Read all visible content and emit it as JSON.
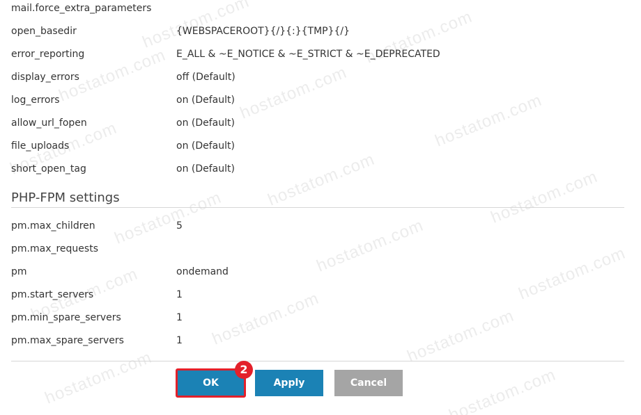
{
  "php_settings": [
    {
      "label": "mail.force_extra_parameters",
      "value": ""
    },
    {
      "label": "open_basedir",
      "value": "{WEBSPACEROOT}{/}{:}{TMP}{/}"
    },
    {
      "label": "error_reporting",
      "value": "E_ALL & ~E_NOTICE & ~E_STRICT & ~E_DEPRECATED"
    },
    {
      "label": "display_errors",
      "value": "off (Default)"
    },
    {
      "label": "log_errors",
      "value": "on (Default)"
    },
    {
      "label": "allow_url_fopen",
      "value": "on (Default)"
    },
    {
      "label": "file_uploads",
      "value": "on (Default)"
    },
    {
      "label": "short_open_tag",
      "value": "on (Default)"
    }
  ],
  "fpm_section": {
    "title": "PHP-FPM settings",
    "settings": [
      {
        "label": "pm.max_children",
        "value": "5"
      },
      {
        "label": "pm.max_requests",
        "value": ""
      },
      {
        "label": "pm",
        "value": "ondemand"
      },
      {
        "label": "pm.start_servers",
        "value": "1"
      },
      {
        "label": "pm.min_spare_servers",
        "value": "1"
      },
      {
        "label": "pm.max_spare_servers",
        "value": "1"
      }
    ]
  },
  "buttons": {
    "ok": "OK",
    "apply": "Apply",
    "cancel": "Cancel"
  },
  "step_badge": "2",
  "watermark": "hostatom.com",
  "colors": {
    "primary_button": "#1b82b5",
    "cancel_button": "#a5a5a5",
    "highlight": "#e3202a"
  }
}
